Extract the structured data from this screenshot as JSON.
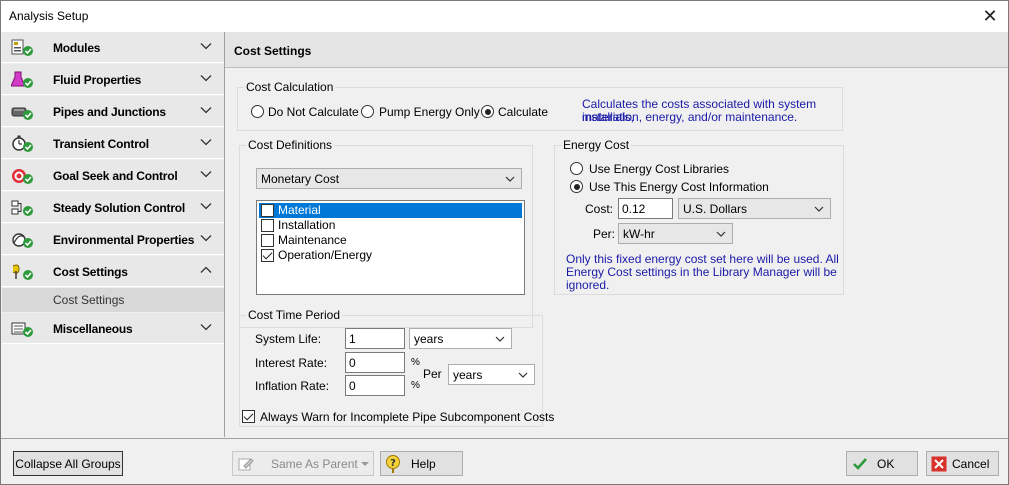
{
  "window": {
    "title": "Analysis Setup",
    "close_glyph": "✕"
  },
  "sidebar": {
    "groups": [
      {
        "label": "Modules",
        "icon": "modules-icon"
      },
      {
        "label": "Fluid Properties",
        "icon": "flask-icon"
      },
      {
        "label": "Pipes and Junctions",
        "icon": "pipe-icon"
      },
      {
        "label": "Transient Control",
        "icon": "stopwatch-icon"
      },
      {
        "label": "Goal Seek and Control",
        "icon": "target-icon"
      },
      {
        "label": "Steady Solution Control",
        "icon": "solution-icon"
      },
      {
        "label": "Environmental Properties",
        "icon": "environment-icon"
      },
      {
        "label": "Cost Settings",
        "icon": "cost-icon",
        "expanded": true
      },
      {
        "label": "Miscellaneous",
        "icon": "misc-icon"
      }
    ],
    "subitem": "Cost Settings"
  },
  "content": {
    "header": "Cost Settings",
    "cost_calculation": {
      "legend": "Cost Calculation",
      "options": [
        "Do Not Calculate",
        "Pump Energy Only",
        "Calculate"
      ],
      "selected": "Calculate",
      "description_line1": "Calculates the costs associated with system materials,",
      "description_line2": "installation, energy, and/or maintenance."
    },
    "cost_definitions": {
      "legend": "Cost Definitions",
      "dropdown": "Monetary Cost",
      "items": [
        {
          "label": "Material",
          "checked": false,
          "selected": true
        },
        {
          "label": "Installation",
          "checked": false,
          "selected": false
        },
        {
          "label": "Maintenance",
          "checked": false,
          "selected": false
        },
        {
          "label": "Operation/Energy",
          "checked": true,
          "selected": false
        }
      ]
    },
    "energy_cost": {
      "legend": "Energy Cost",
      "option1": "Use Energy Cost Libraries",
      "option2": "Use This Energy Cost Information",
      "selected": "Use This Energy Cost Information",
      "cost_label": "Cost:",
      "cost_value": "0.12",
      "currency": "U.S. Dollars",
      "per_label": "Per:",
      "per_value": "kW-hr",
      "note_line1": "Only this fixed energy cost set here will be used. All",
      "note_line2": "Energy Cost settings in the Library Manager will be",
      "note_line3": "ignored."
    },
    "cost_time_period": {
      "legend": "Cost Time Period",
      "system_life_label": "System Life:",
      "system_life_value": "1",
      "system_life_unit": "years",
      "interest_label": "Interest Rate:",
      "interest_value": "0",
      "inflation_label": "Inflation Rate:",
      "inflation_value": "0",
      "percent": "%",
      "per_label": "Per",
      "per_value": "years"
    },
    "warn_checkbox": {
      "label": "Always Warn for Incomplete Pipe Subcomponent Costs",
      "checked": true
    }
  },
  "footer": {
    "collapse": "Collapse All Groups",
    "same_as_parent": "Same As Parent",
    "help": "Help",
    "ok": "OK",
    "cancel": "Cancel"
  }
}
